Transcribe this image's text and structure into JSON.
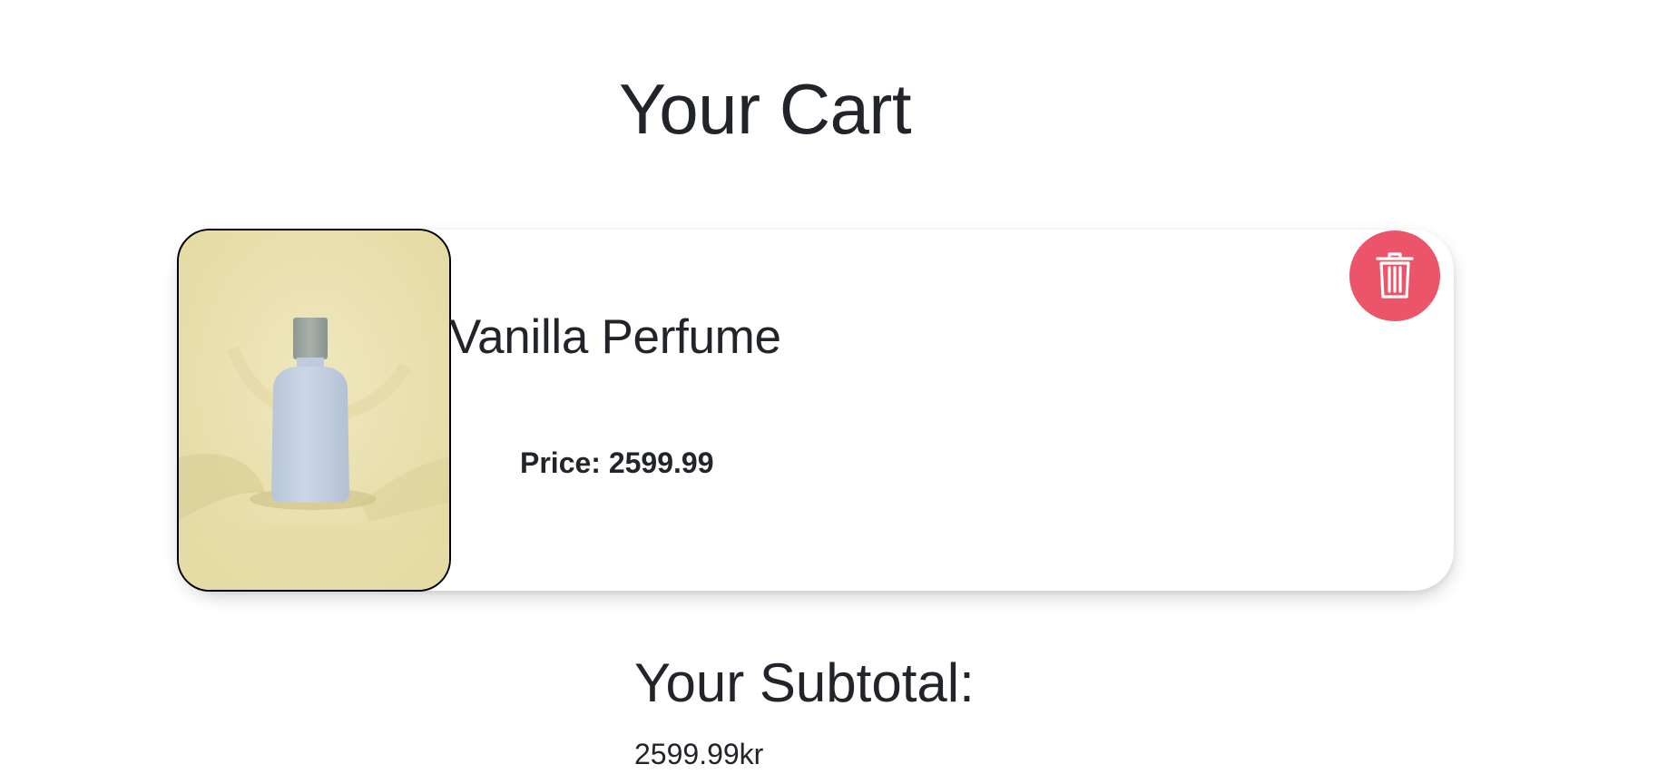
{
  "page": {
    "title": "Your Cart"
  },
  "cart": {
    "items": [
      {
        "name": "Vanilla Perfume",
        "price_label": "Price: 2599.99",
        "image_icon": "perfume-bottle-image",
        "delete_icon": "trash-icon"
      }
    ]
  },
  "subtotal": {
    "label": "Your Subtotal:",
    "value": "2599.99kr"
  },
  "colors": {
    "text": "#212529",
    "delete_button": "#eb5469",
    "image_background": "#e8dfad",
    "bottle": "#c6d3e6",
    "cap": "#9ea6a0"
  }
}
